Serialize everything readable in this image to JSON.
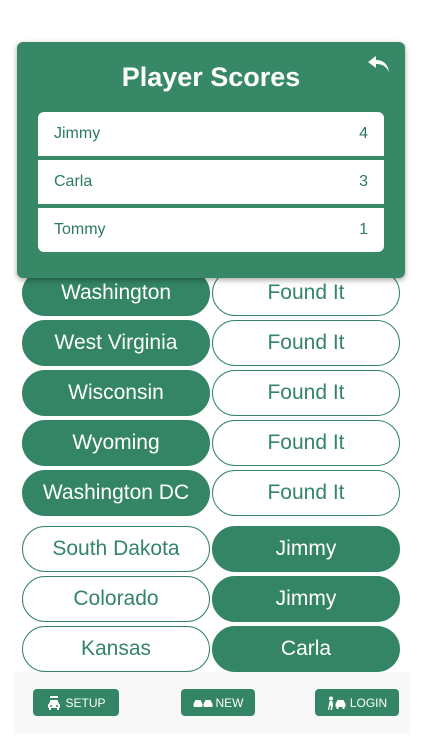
{
  "scores_modal": {
    "title": "Player Scores",
    "players": [
      {
        "name": "Jimmy",
        "score": "4"
      },
      {
        "name": "Carla",
        "score": "3"
      },
      {
        "name": "Tommy",
        "score": "1"
      }
    ]
  },
  "states": [
    {
      "state": "Washington",
      "status": "Found It"
    },
    {
      "state": "West Virginia",
      "status": "Found It"
    },
    {
      "state": "Wisconsin",
      "status": "Found It"
    },
    {
      "state": "Wyoming",
      "status": "Found It"
    },
    {
      "state": "Washington DC",
      "status": "Found It"
    }
  ],
  "found": [
    {
      "state": "South Dakota",
      "player": "Jimmy"
    },
    {
      "state": "Colorado",
      "player": "Jimmy"
    },
    {
      "state": "Kansas",
      "player": "Carla"
    }
  ],
  "nav": {
    "setup_label": "SETUP",
    "new_label": "NEW",
    "login_label": "LOGIN"
  },
  "colors": {
    "accent": "#348565",
    "modal_bg": "#368867",
    "text_on_white": "#2e7a5c"
  }
}
